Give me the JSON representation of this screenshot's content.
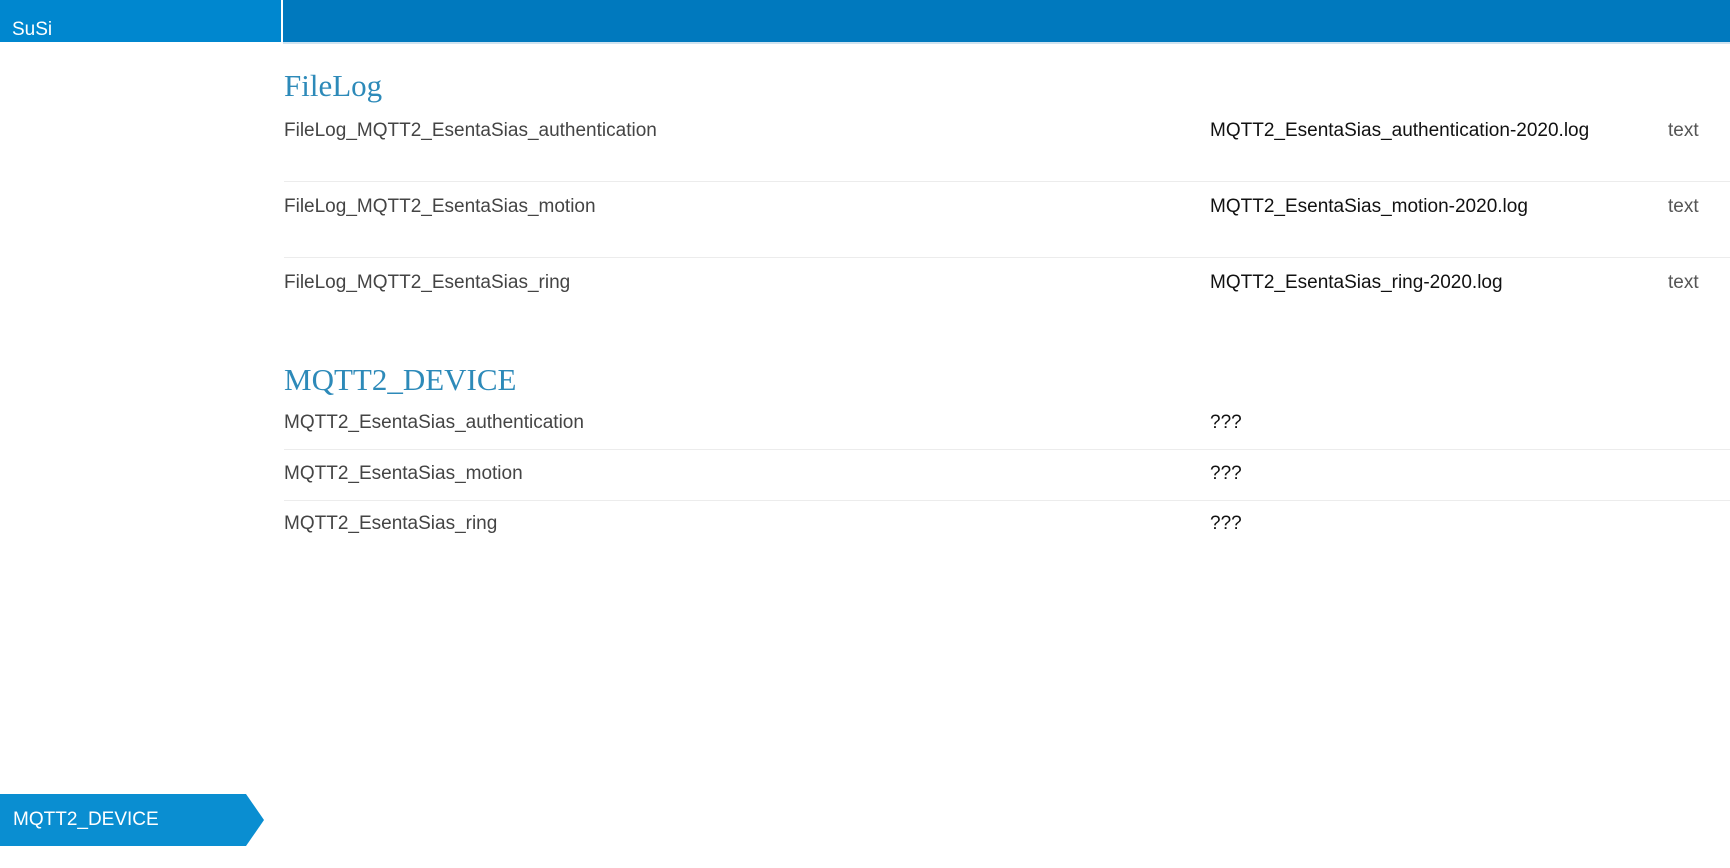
{
  "header": {
    "brand": "SuSi"
  },
  "sections": {
    "filelog": {
      "title": "FileLog",
      "rows": [
        {
          "name": "FileLog_MQTT2_EsentaSias_authentication",
          "file": "MQTT2_EsentaSias_authentication-2020.log",
          "type": "text"
        },
        {
          "name": "FileLog_MQTT2_EsentaSias_motion",
          "file": "MQTT2_EsentaSias_motion-2020.log",
          "type": "text"
        },
        {
          "name": "FileLog_MQTT2_EsentaSias_ring",
          "file": "MQTT2_EsentaSias_ring-2020.log",
          "type": "text"
        }
      ]
    },
    "mqtt2_device": {
      "title": "MQTT2_DEVICE",
      "rows": [
        {
          "name": "MQTT2_EsentaSias_authentication",
          "state": "???"
        },
        {
          "name": "MQTT2_EsentaSias_motion",
          "state": "???"
        },
        {
          "name": "MQTT2_EsentaSias_ring",
          "state": "???"
        }
      ]
    }
  },
  "sidebar": {
    "active_item": "MQTT2_DEVICE"
  },
  "colors": {
    "topbar": "#0079be",
    "brand_bg": "#0087cf",
    "section_title": "#2d8ab9",
    "nav_arrow": "#0a8ed1"
  }
}
